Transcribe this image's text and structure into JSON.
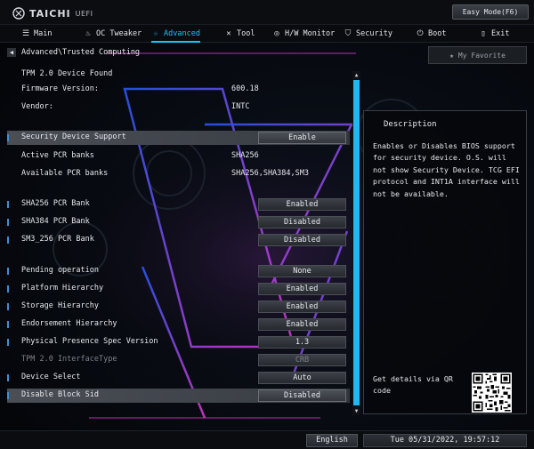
{
  "header": {
    "logo_text": "TAICHI",
    "logo_sub": "UEFI",
    "mode_button": "Easy Mode(F6)"
  },
  "nav": {
    "tabs": [
      {
        "label": "Main",
        "icon": "list-icon"
      },
      {
        "label": "OC Tweaker",
        "icon": "flame-icon"
      },
      {
        "label": "Advanced",
        "icon": "advanced-star-icon",
        "active": true
      },
      {
        "label": "Tool",
        "icon": "tools-icon"
      },
      {
        "label": "H/W Monitor",
        "icon": "monitor-icon"
      },
      {
        "label": "Security",
        "icon": "shield-icon"
      },
      {
        "label": "Boot",
        "icon": "power-icon"
      },
      {
        "label": "Exit",
        "icon": "exit-icon"
      }
    ]
  },
  "breadcrumb": "Advanced\\Trusted Computing",
  "favorite_button": "My Favorite",
  "info": {
    "device_found": "TPM 2.0 Device Found",
    "firmware_label": "Firmware Version:",
    "firmware_value": "600.18",
    "vendor_label": "Vendor:",
    "vendor_value": "INTC"
  },
  "settings": {
    "security_device_support": {
      "label": "Security Device Support",
      "value": "Enable"
    },
    "active_pcr_banks": {
      "label": "Active PCR banks",
      "value": "SHA256"
    },
    "available_pcr_banks": {
      "label": "Available PCR banks",
      "value": "SHA256,SHA384,SM3"
    },
    "sha256_bank": {
      "label": "SHA256 PCR Bank",
      "value": "Enabled"
    },
    "sha384_bank": {
      "label": "SHA384 PCR Bank",
      "value": "Disabled"
    },
    "sm3_bank": {
      "label": "SM3_256 PCR Bank",
      "value": "Disabled"
    },
    "pending_operation": {
      "label": "Pending operation",
      "value": "None"
    },
    "platform_hierarchy": {
      "label": "Platform Hierarchy",
      "value": "Enabled"
    },
    "storage_hierarchy": {
      "label": "Storage Hierarchy",
      "value": "Enabled"
    },
    "endorsement_hierarchy": {
      "label": "Endorsement Hierarchy",
      "value": "Enabled"
    },
    "physical_presence": {
      "label": "Physical Presence Spec Version",
      "value": "1.3"
    },
    "tpm_interface_type": {
      "label": "TPM 2.0 InterfaceType",
      "value": "CRB"
    },
    "device_select": {
      "label": "Device Select",
      "value": "Auto"
    },
    "disable_block_sid": {
      "label": "Disable Block Sid",
      "value": "Disabled"
    }
  },
  "description": {
    "title": "Description",
    "body": "Enables or Disables BIOS support\nfor security device. O.S. will\nnot show Security Device. TCG EFI\nprotocol and INT1A interface will\nnot be available.",
    "qr_text": "Get details via QR\ncode"
  },
  "footer": {
    "language": "English",
    "datetime": "Tue 05/31/2022, 19:57:12"
  },
  "colors": {
    "accent": "#19c3ff",
    "scrollbar": "#1fb8f2",
    "neon_pink": "#d83ad0",
    "neon_blue": "#3a8cff"
  }
}
